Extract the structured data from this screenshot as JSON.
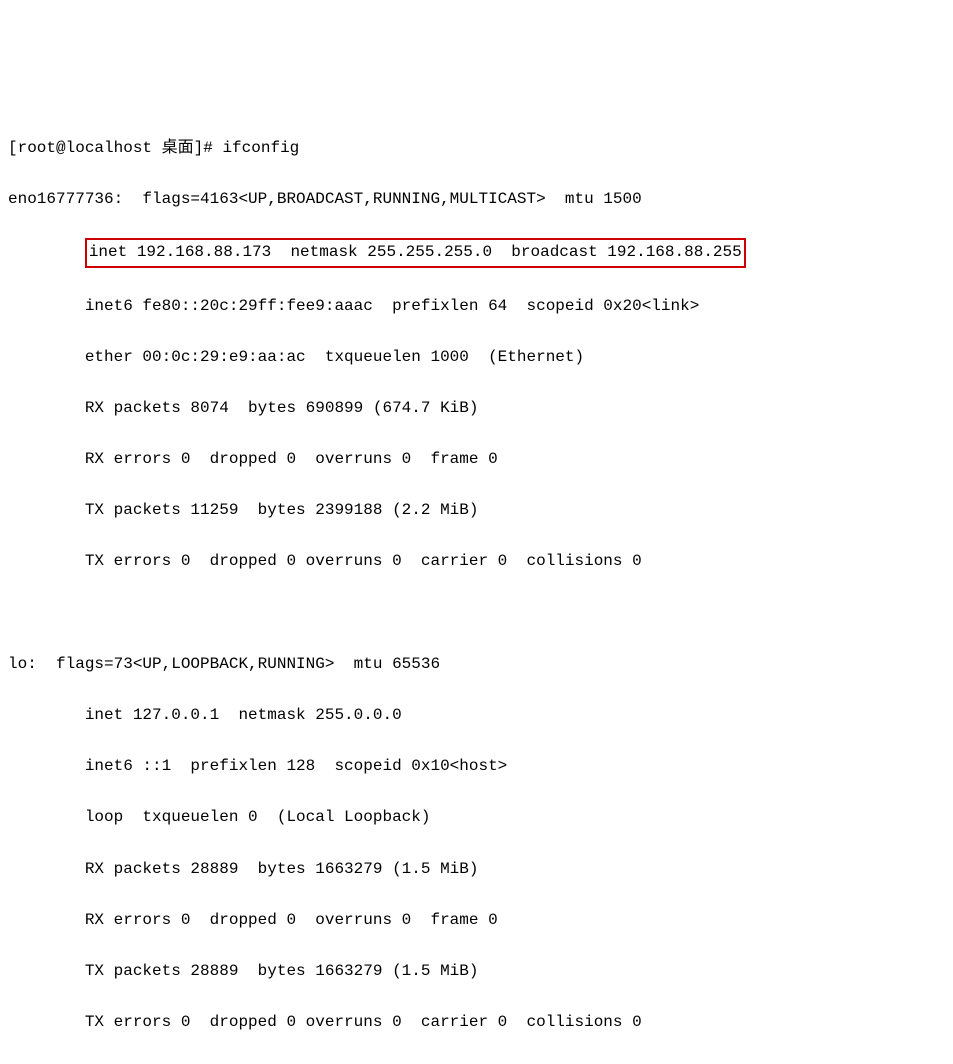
{
  "prompt": {
    "user_host": "[root@localhost 桌面]#",
    "command": "ifconfig"
  },
  "interfaces": {
    "eno": {
      "name": "eno16777736:",
      "flags_line": "  flags=4163<UP,BROADCAST,RUNNING,MULTICAST>  mtu 1500",
      "inet_line": "inet 192.168.88.173  netmask 255.255.255.0  broadcast 192.168.88.255",
      "inet6_line": "        inet6 fe80::20c:29ff:fee9:aaac  prefixlen 64  scopeid 0x20<link>",
      "ether_line": "        ether 00:0c:29:e9:aa:ac  txqueuelen 1000  (Ethernet)",
      "rx_packets": "        RX packets 8074  bytes 690899 (674.7 KiB)",
      "rx_errors": "        RX errors 0  dropped 0  overruns 0  frame 0",
      "tx_packets": "        TX packets 11259  bytes 2399188 (2.2 MiB)",
      "tx_errors": "        TX errors 0  dropped 0 overruns 0  carrier 0  collisions 0"
    },
    "lo": {
      "name_line": "lo:  flags=73<UP,LOOPBACK,RUNNING>  mtu 65536",
      "inet_line": "        inet 127.0.0.1  netmask 255.0.0.0",
      "inet6_line": "        inet6 ::1  prefixlen 128  scopeid 0x10<host>",
      "loop_line": "        loop  txqueuelen 0  (Local Loopback)",
      "rx_packets": "        RX packets 28889  bytes 1663279 (1.5 MiB)",
      "rx_errors": "        RX errors 0  dropped 0  overruns 0  frame 0",
      "tx_packets": "        TX packets 28889  bytes 1663279 (1.5 MiB)",
      "tx_errors": "        TX errors 0  dropped 0 overruns 0  carrier 0  collisions 0"
    }
  }
}
